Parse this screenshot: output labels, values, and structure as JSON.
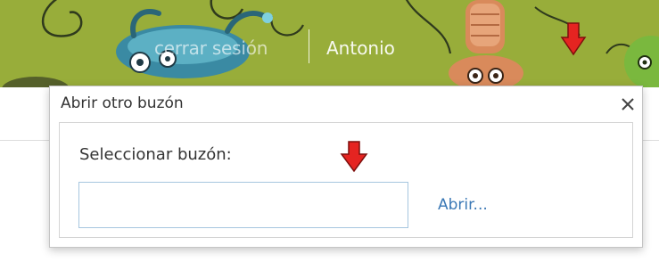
{
  "header": {
    "signout_label": "cerrar sesión",
    "user_name": "Antonio",
    "theme_color": "#98ad3a"
  },
  "dialog": {
    "title": "Abrir otro buzón",
    "close_icon": "close-icon",
    "field_label": "Seleccionar buzón:",
    "input_value": "",
    "input_placeholder": "",
    "open_label": "Abrir..."
  },
  "annotations": {
    "arrow_icon": "arrow-down-icon",
    "arrow_color": "#e52421"
  }
}
